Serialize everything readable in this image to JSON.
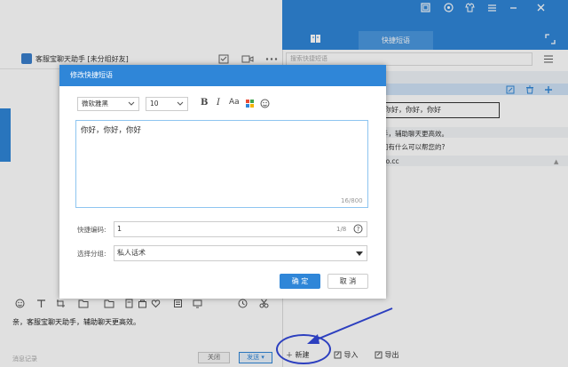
{
  "window": {
    "tab_active": "快捷短语",
    "icons": [
      "window-icon",
      "settings-icon",
      "shirt-icon",
      "menu-icon",
      "minimize-icon",
      "close-icon",
      "book-icon",
      "expand-icon"
    ]
  },
  "chat": {
    "title": "客服宝聊天助手 [未分组好友]",
    "message": "亲，客服宝聊天助手，辅助聊天更高效。",
    "footer": "消息记录",
    "close_label": "关闭",
    "send_label": "发送",
    "toolbar_icons": [
      "emoji-icon",
      "text-icon",
      "crop-icon",
      "folder-icon",
      "folder-2-icon",
      "doc-icon",
      "bag-icon",
      "heart-icon",
      "note-icon",
      "screen-icon",
      "history-icon",
      "scissors-icon"
    ]
  },
  "right": {
    "search_placeholder": "搜索快捷短语",
    "selected_item": "你好，你好，你好",
    "items": [
      "手，辅助聊天更高效。",
      "问有什么可以帮您的?",
      "ao.cc"
    ],
    "new_label": "新建",
    "import_label": "导入",
    "export_label": "导出"
  },
  "dialog": {
    "title": "修改快捷短语",
    "font": "微软雅黑",
    "size": "10",
    "bold": "B",
    "italic": "I",
    "font_color": "Aa",
    "content": "你好，你好，你好",
    "counter": "16/800",
    "code_label": "快捷编码:",
    "code_value": "1",
    "code_count": "1/8",
    "group_label": "选择分组:",
    "group_value": "私人话术",
    "ok_label": "确 定",
    "cancel_label": "取 消"
  },
  "colors": {
    "accent": "#2f86d8",
    "annotation": "#2c3fbf"
  }
}
